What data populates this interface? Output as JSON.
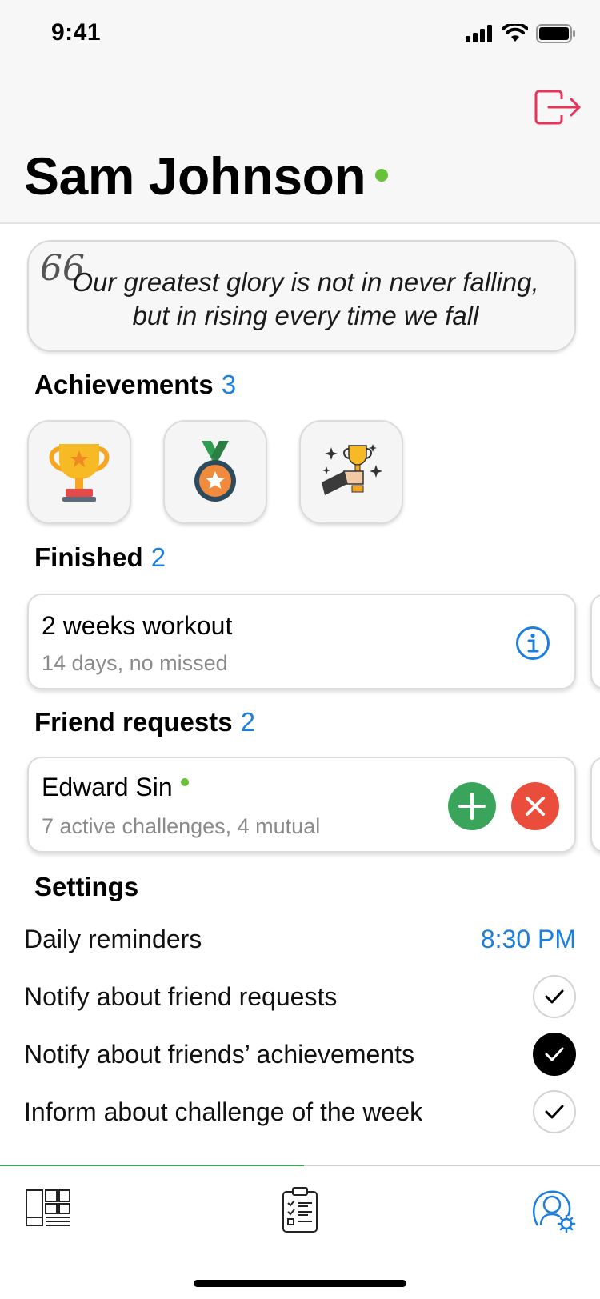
{
  "status_bar": {
    "time": "9:41"
  },
  "profile": {
    "name": "Sam Johnson"
  },
  "quote": {
    "mark": "66",
    "text": "Our greatest glory is not in never falling, but in rising every time we fall"
  },
  "achievements": {
    "title": "Achievements",
    "count": "3",
    "items": [
      {
        "icon": "trophy-icon"
      },
      {
        "icon": "medal-icon"
      },
      {
        "icon": "trophy-hand-icon"
      }
    ]
  },
  "finished": {
    "title": "Finished",
    "count": "2",
    "card": {
      "title": "2 weeks workout",
      "subtitle": "14 days, no missed"
    }
  },
  "friend_requests": {
    "title": "Friend requests",
    "count": "2",
    "card": {
      "name": "Edward Sin",
      "subtitle": "7 active challenges, 4 mutual"
    }
  },
  "settings": {
    "title": "Settings",
    "daily_reminders": {
      "label": "Daily reminders",
      "value": "8:30 PM"
    },
    "toggles": [
      {
        "label": "Notify about friend requests",
        "checked": false
      },
      {
        "label": "Notify about friends’ achievements",
        "checked": true
      },
      {
        "label": "Inform about challenge of the week",
        "checked": false
      }
    ]
  },
  "tabbar": {
    "tabs": [
      {
        "icon": "dashboard-icon"
      },
      {
        "icon": "clipboard-checklist-icon"
      },
      {
        "icon": "profile-settings-icon",
        "active": true
      }
    ]
  },
  "colors": {
    "accent": "#1a7fe0",
    "online": "#67c23a",
    "accept": "#3aa55a",
    "decline": "#eb4d3d",
    "logout": "#e8345a"
  }
}
